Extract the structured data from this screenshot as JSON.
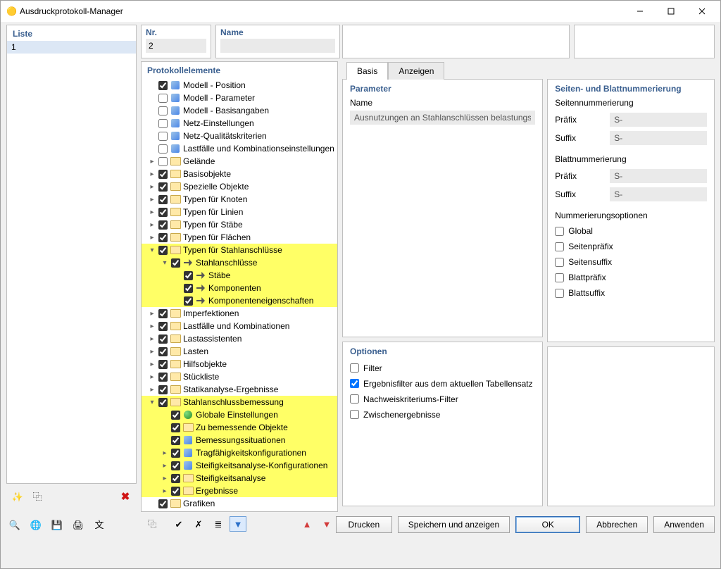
{
  "window": {
    "title": "Ausdruckprotokoll-Manager"
  },
  "liste": {
    "heading": "Liste",
    "items": [
      "1"
    ]
  },
  "header": {
    "nr": {
      "label": "Nr.",
      "value": "2"
    },
    "name": {
      "label": "Name",
      "value": ""
    }
  },
  "proto": {
    "heading": "Protokollelemente",
    "items": [
      {
        "label": "Modell - Position",
        "checked": true,
        "chev": "",
        "icon": "other",
        "indent": 0,
        "hl": false
      },
      {
        "label": "Modell - Parameter",
        "checked": false,
        "chev": "",
        "icon": "other",
        "indent": 0,
        "hl": false
      },
      {
        "label": "Modell - Basisangaben",
        "checked": false,
        "chev": "",
        "icon": "other",
        "indent": 0,
        "hl": false
      },
      {
        "label": "Netz-Einstellungen",
        "checked": false,
        "chev": "",
        "icon": "other",
        "indent": 0,
        "hl": false
      },
      {
        "label": "Netz-Qualitätskriterien",
        "checked": false,
        "chev": "",
        "icon": "other",
        "indent": 0,
        "hl": false
      },
      {
        "label": "Lastfälle und Kombinationseinstellungen",
        "checked": false,
        "chev": "",
        "icon": "other",
        "indent": 0,
        "hl": false
      },
      {
        "label": "Gelände",
        "checked": false,
        "chev": ">",
        "icon": "folder",
        "indent": 0,
        "hl": false
      },
      {
        "label": "Basisobjekte",
        "checked": true,
        "chev": ">",
        "icon": "folder",
        "indent": 0,
        "hl": false
      },
      {
        "label": "Spezielle Objekte",
        "checked": true,
        "chev": ">",
        "icon": "folder",
        "indent": 0,
        "hl": false
      },
      {
        "label": "Typen für Knoten",
        "checked": true,
        "chev": ">",
        "icon": "folder",
        "indent": 0,
        "hl": false
      },
      {
        "label": "Typen für Linien",
        "checked": true,
        "chev": ">",
        "icon": "folder",
        "indent": 0,
        "hl": false
      },
      {
        "label": "Typen für Stäbe",
        "checked": true,
        "chev": ">",
        "icon": "folder",
        "indent": 0,
        "hl": false
      },
      {
        "label": "Typen für Flächen",
        "checked": true,
        "chev": ">",
        "icon": "folder",
        "indent": 0,
        "hl": false
      },
      {
        "label": "Typen für Stahlanschlüsse",
        "checked": true,
        "chev": "v",
        "icon": "folder",
        "indent": 0,
        "hl": true,
        "pointer": true
      },
      {
        "label": "Stahlanschlüsse",
        "checked": true,
        "chev": "v",
        "icon": "sc",
        "indent": 1,
        "hl": true
      },
      {
        "label": "Stäbe",
        "checked": true,
        "chev": "",
        "icon": "sc",
        "indent": 2,
        "hl": true
      },
      {
        "label": "Komponenten",
        "checked": true,
        "chev": "",
        "icon": "sc",
        "indent": 2,
        "hl": true
      },
      {
        "label": "Komponenteneigenschaften",
        "checked": true,
        "chev": "",
        "icon": "sc",
        "indent": 2,
        "hl": true
      },
      {
        "label": "Imperfektionen",
        "checked": true,
        "chev": ">",
        "icon": "folder",
        "indent": 0,
        "hl": false
      },
      {
        "label": "Lastfälle und Kombinationen",
        "checked": true,
        "chev": ">",
        "icon": "folder",
        "indent": 0,
        "hl": false
      },
      {
        "label": "Lastassistenten",
        "checked": true,
        "chev": ">",
        "icon": "folder",
        "indent": 0,
        "hl": false
      },
      {
        "label": "Lasten",
        "checked": true,
        "chev": ">",
        "icon": "folder",
        "indent": 0,
        "hl": false
      },
      {
        "label": "Hilfsobjekte",
        "checked": true,
        "chev": ">",
        "icon": "folder",
        "indent": 0,
        "hl": false
      },
      {
        "label": "Stückliste",
        "checked": true,
        "chev": ">",
        "icon": "folder",
        "indent": 0,
        "hl": false
      },
      {
        "label": "Statikanalyse-Ergebnisse",
        "checked": true,
        "chev": ">",
        "icon": "folder",
        "indent": 0,
        "hl": false
      },
      {
        "label": "Stahlanschlussbemessung",
        "checked": true,
        "chev": "v",
        "icon": "folder",
        "indent": 0,
        "hl": true,
        "pointer": true
      },
      {
        "label": "Globale Einstellungen",
        "checked": true,
        "chev": "",
        "icon": "glob",
        "indent": 1,
        "hl": true
      },
      {
        "label": "Zu bemessende Objekte",
        "checked": true,
        "chev": "",
        "icon": "folder",
        "indent": 1,
        "hl": true
      },
      {
        "label": "Bemessungssituationen",
        "checked": true,
        "chev": "",
        "icon": "other",
        "indent": 1,
        "hl": true
      },
      {
        "label": "Tragfähigkeitskonfigurationen",
        "checked": true,
        "chev": ">",
        "icon": "other",
        "indent": 1,
        "hl": true
      },
      {
        "label": "Steifigkeitsanalyse-Konfigurationen",
        "checked": true,
        "chev": ">",
        "icon": "other",
        "indent": 1,
        "hl": true
      },
      {
        "label": "Steifigkeitsanalyse",
        "checked": true,
        "chev": ">",
        "icon": "folder",
        "indent": 1,
        "hl": true
      },
      {
        "label": "Ergebnisse",
        "checked": true,
        "chev": ">",
        "icon": "folder",
        "indent": 1,
        "hl": true
      },
      {
        "label": "Grafiken",
        "checked": true,
        "chev": "",
        "icon": "folder",
        "indent": 0,
        "hl": false
      }
    ]
  },
  "tabs": {
    "basis": "Basis",
    "anzeigen": "Anzeigen"
  },
  "parameter": {
    "heading": "Parameter",
    "name_label": "Name",
    "name_value": "Ausnutzungen an Stahlanschlüssen belastungsw"
  },
  "numbering": {
    "heading": "Seiten- und Blattnummerierung",
    "seiten_h": "Seitennummerierung",
    "blatt_h": "Blattnummerierung",
    "prefix": "Präfix",
    "suffix": "Suffix",
    "s_value": "S-",
    "opts_h": "Nummerierungsoptionen",
    "opts": [
      {
        "label": "Global",
        "checked": false
      },
      {
        "label": "Seitenpräfix",
        "checked": false
      },
      {
        "label": "Seitensuffix",
        "checked": false
      },
      {
        "label": "Blattpräfix",
        "checked": false
      },
      {
        "label": "Blattsuffix",
        "checked": false
      }
    ]
  },
  "options": {
    "heading": "Optionen",
    "opts": [
      {
        "label": "Filter",
        "checked": false
      },
      {
        "label": "Ergebnisfilter aus dem aktuellen Tabellensatz",
        "checked": true
      },
      {
        "label": "Nachweiskriteriums-Filter",
        "checked": false
      },
      {
        "label": "Zwischenergebnisse",
        "checked": false
      }
    ]
  },
  "buttons": {
    "drucken": "Drucken",
    "speichern": "Speichern und anzeigen",
    "ok": "OK",
    "abbrechen": "Abbrechen",
    "anwenden": "Anwenden"
  }
}
